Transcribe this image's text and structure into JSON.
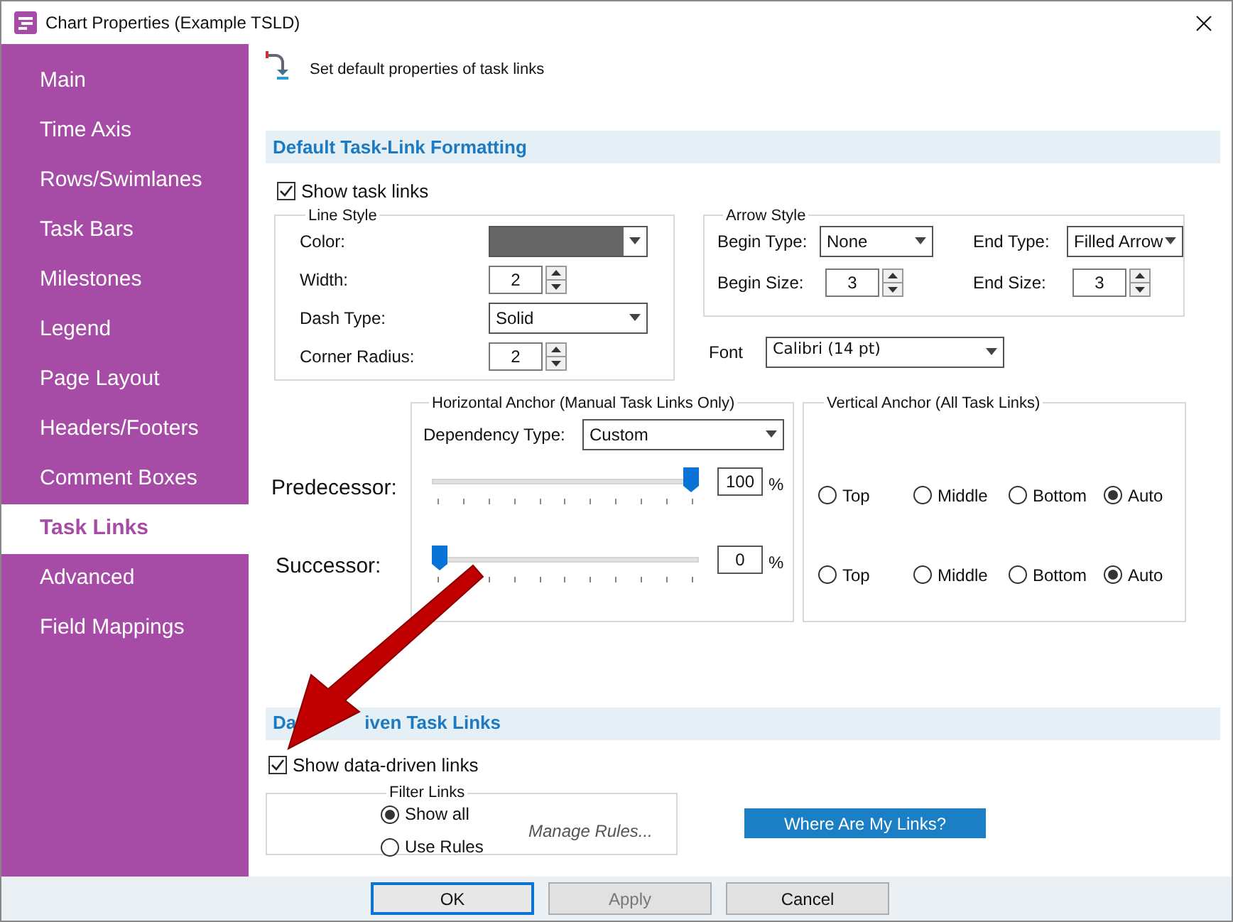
{
  "window": {
    "title": "Chart Properties (Example TSLD)"
  },
  "sidebar": {
    "items": [
      {
        "label": "Main",
        "selected": false
      },
      {
        "label": "Time Axis",
        "selected": false
      },
      {
        "label": "Rows/Swimlanes",
        "selected": false
      },
      {
        "label": "Task Bars",
        "selected": false
      },
      {
        "label": "Milestones",
        "selected": false
      },
      {
        "label": "Legend",
        "selected": false
      },
      {
        "label": "Page Layout",
        "selected": false
      },
      {
        "label": "Headers/Footers",
        "selected": false
      },
      {
        "label": "Comment Boxes",
        "selected": false
      },
      {
        "label": "Task Links",
        "selected": true
      },
      {
        "label": "Advanced",
        "selected": false
      },
      {
        "label": "Field Mappings",
        "selected": false
      }
    ]
  },
  "header": {
    "text": "Set default properties of task links"
  },
  "default_formatting": {
    "title": "Default Task-Link Formatting",
    "show_task_links": {
      "label": "Show task links",
      "checked": true
    },
    "line_style": {
      "title": "Line Style",
      "fields": [
        {
          "kind": "color",
          "label": "Color:",
          "color": "#666666"
        },
        {
          "kind": "spin",
          "label": "Width:",
          "value": "2"
        },
        {
          "kind": "dropdown",
          "label": "Dash Type:",
          "value": "Solid"
        },
        {
          "kind": "spin",
          "label": "Corner Radius:",
          "value": "2"
        }
      ]
    },
    "arrow_style": {
      "title": "Arrow Style",
      "fields": [
        {
          "kind": "dropdown",
          "label": "Begin Type:",
          "value": "None"
        },
        {
          "kind": "dropdown",
          "label": "End Type:",
          "value": "Filled Arrow"
        },
        {
          "kind": "spin",
          "label": "Begin Size:",
          "value": "3"
        },
        {
          "kind": "spin",
          "label": "End Size:",
          "value": "3"
        }
      ]
    },
    "font": {
      "label": "Font",
      "value": "Calibri (14 pt)"
    },
    "horizontal_anchor": {
      "title": "Horizontal Anchor (Manual Task Links Only)",
      "dependency_type": {
        "label": "Dependency Type:",
        "value": "Custom"
      }
    },
    "vertical_anchor": {
      "title": "Vertical Anchor (All Task Links)"
    },
    "anchors": [
      {
        "label": "Predecessor:",
        "level": 1,
        "value": "100",
        "unit": "%",
        "options": [
          {
            "label": "Top",
            "selected": false
          },
          {
            "label": "Middle",
            "selected": false
          },
          {
            "label": "Bottom",
            "selected": false
          },
          {
            "label": "Auto",
            "selected": true
          }
        ]
      },
      {
        "label": "Successor:",
        "level": 0,
        "value": "0",
        "unit": "%",
        "options": [
          {
            "label": "Top",
            "selected": false
          },
          {
            "label": "Middle",
            "selected": false
          },
          {
            "label": "Bottom",
            "selected": false
          },
          {
            "label": "Auto",
            "selected": true
          }
        ]
      }
    ]
  },
  "data_driven": {
    "title_parts": [
      "Da",
      "iven Task Links"
    ],
    "show": {
      "label": "Show data-driven links",
      "checked": true
    },
    "filter_links": {
      "title": "Filter Links",
      "options": [
        {
          "label": "Show all",
          "selected": true
        },
        {
          "label": "Use Rules",
          "selected": false
        }
      ],
      "manage_rules": "Manage Rules..."
    },
    "where_button": "Where Are My Links?"
  },
  "buttons": [
    {
      "label": "OK",
      "default": true,
      "disabled": false
    },
    {
      "label": "Apply",
      "default": false,
      "disabled": true
    },
    {
      "label": "Cancel",
      "default": false,
      "disabled": false
    }
  ]
}
